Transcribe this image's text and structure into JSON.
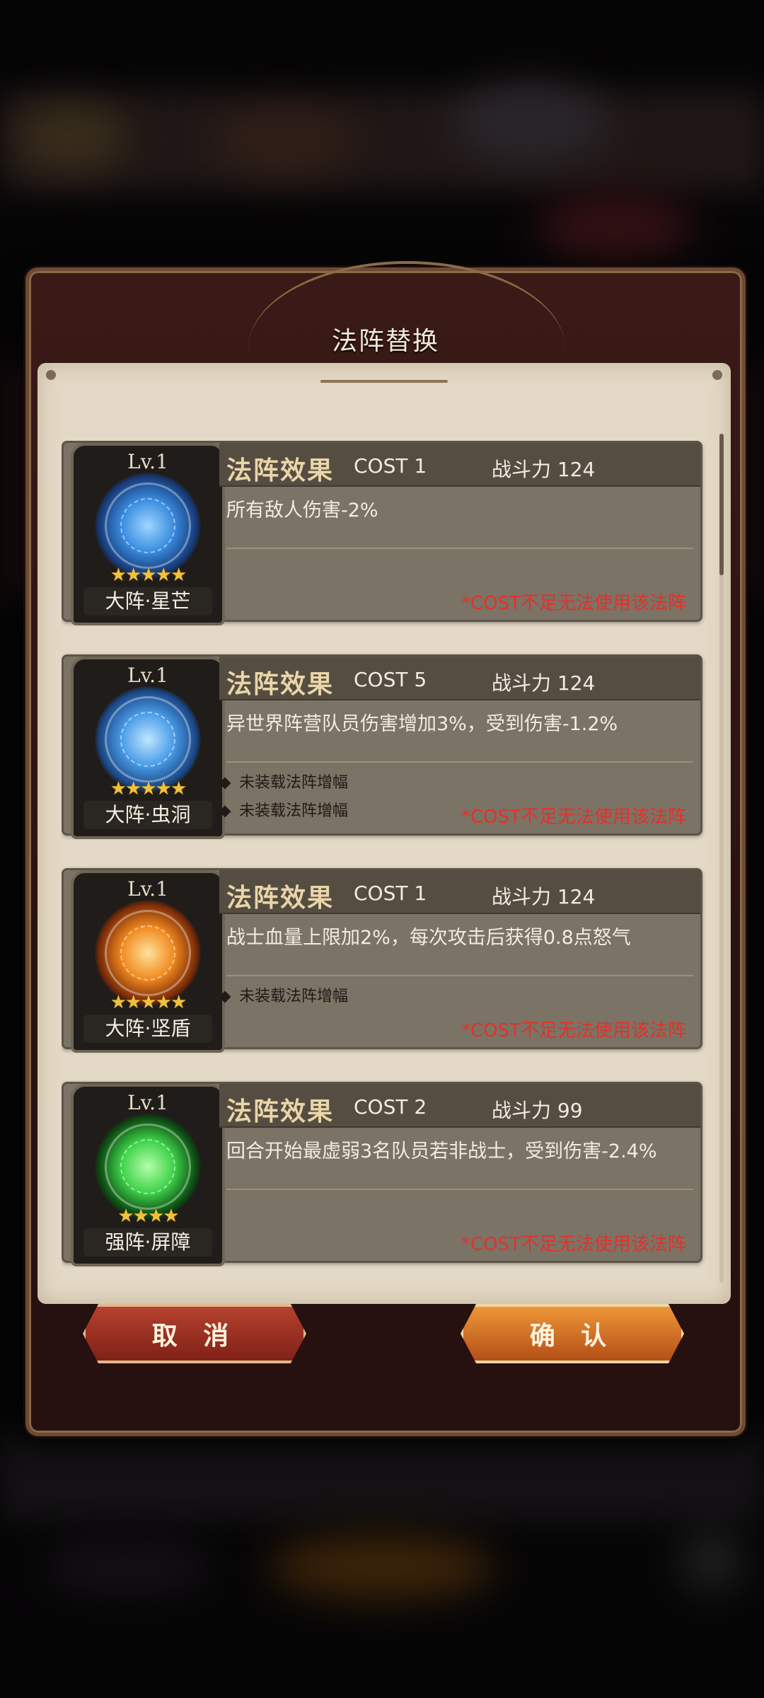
{
  "modal": {
    "title": "法阵替换",
    "cancel_label": "取 消",
    "confirm_label": "确 认"
  },
  "colors": {
    "warning": "#e5302a",
    "star": "#f0c23c",
    "blue_glow": "#3a8ce0",
    "orange_glow": "#f08a20",
    "green_glow": "#3fd24a"
  },
  "cards": [
    {
      "level": "Lv.1",
      "name": "大阵·星芒",
      "stars": "★★★★★",
      "icon": "blue-magic-circle-icon",
      "effect_label": "法阵效果",
      "cost": "COST 1",
      "power": "战斗力 124",
      "description": "所有敌人伤害-2%",
      "bullets": [],
      "warning": "*COST不足无法使用该法阵"
    },
    {
      "level": "Lv.1",
      "name": "大阵·虫洞",
      "stars": "★★★★★",
      "icon": "blue-hexagram-circle-icon",
      "effect_label": "法阵效果",
      "cost": "COST 5",
      "power": "战斗力 124",
      "description": "异世界阵营队员伤害增加3%，受到伤害-1.2%",
      "bullets": [
        "未装载法阵增幅",
        "未装载法阵增幅"
      ],
      "warning": "*COST不足无法使用该法阵"
    },
    {
      "level": "Lv.1",
      "name": "大阵·坚盾",
      "stars": "★★★★★",
      "icon": "orange-magic-circle-icon",
      "effect_label": "法阵效果",
      "cost": "COST 1",
      "power": "战斗力 124",
      "description": "战士血量上限加2%，每次攻击后获得0.8点怒气",
      "bullets": [
        "未装载法阵增幅"
      ],
      "warning": "*COST不足无法使用该法阵"
    },
    {
      "level": "Lv.1",
      "name": "强阵·屏障",
      "stars": "★★★★",
      "icon": "green-magic-circle-icon",
      "effect_label": "法阵效果",
      "cost": "COST 2",
      "power": "战斗力 99",
      "description": "回合开始最虚弱3名队员若非战士，受到伤害-2.4%",
      "bullets": [],
      "warning": "*COST不足无法使用该法阵"
    }
  ]
}
